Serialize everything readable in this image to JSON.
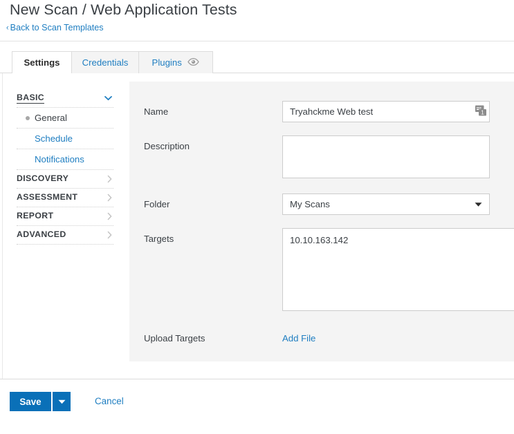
{
  "header": {
    "title": "New Scan / Web Application Tests",
    "back_link": "Back to Scan Templates",
    "back_chevron": "chevron-left-icon"
  },
  "tabs": [
    {
      "id": "settings",
      "label": "Settings",
      "active": true,
      "icon": null
    },
    {
      "id": "credentials",
      "label": "Credentials",
      "active": false,
      "icon": null
    },
    {
      "id": "plugins",
      "label": "Plugins",
      "active": false,
      "icon": "eye-icon"
    }
  ],
  "sidebar": {
    "groups": [
      {
        "label": "BASIC",
        "expanded": true,
        "chevron": "chevron-down-icon",
        "items": [
          {
            "label": "General",
            "active": true
          },
          {
            "label": "Schedule",
            "active": false
          },
          {
            "label": "Notifications",
            "active": false
          }
        ]
      },
      {
        "label": "DISCOVERY",
        "expanded": false,
        "chevron": "chevron-right-icon",
        "items": []
      },
      {
        "label": "ASSESSMENT",
        "expanded": false,
        "chevron": "chevron-right-icon",
        "items": []
      },
      {
        "label": "REPORT",
        "expanded": false,
        "chevron": "chevron-right-icon",
        "items": []
      },
      {
        "label": "ADVANCED",
        "expanded": false,
        "chevron": "chevron-right-icon",
        "items": []
      }
    ]
  },
  "form": {
    "name": {
      "label": "Name",
      "value": "Tryahckme Web test",
      "placeholder": "",
      "trailing_icon": "input-method-icon"
    },
    "description": {
      "label": "Description",
      "value": "",
      "placeholder": ""
    },
    "folder": {
      "label": "Folder",
      "value": "My Scans",
      "caret": "caret-down-icon",
      "options": [
        "My Scans"
      ]
    },
    "targets": {
      "label": "Targets",
      "value": "10.10.163.142",
      "placeholder": ""
    },
    "upload_targets": {
      "label": "Upload Targets",
      "link_label": "Add File"
    }
  },
  "footer": {
    "save_label": "Save",
    "save_caret": "caret-down-icon",
    "cancel_label": "Cancel"
  },
  "colors": {
    "accent_blue": "#0a70b8",
    "link_blue": "#1f7ec1",
    "panel_grey": "#f4f4f4",
    "text_dark": "#3a3f44",
    "border_grey": "#cccccc"
  }
}
